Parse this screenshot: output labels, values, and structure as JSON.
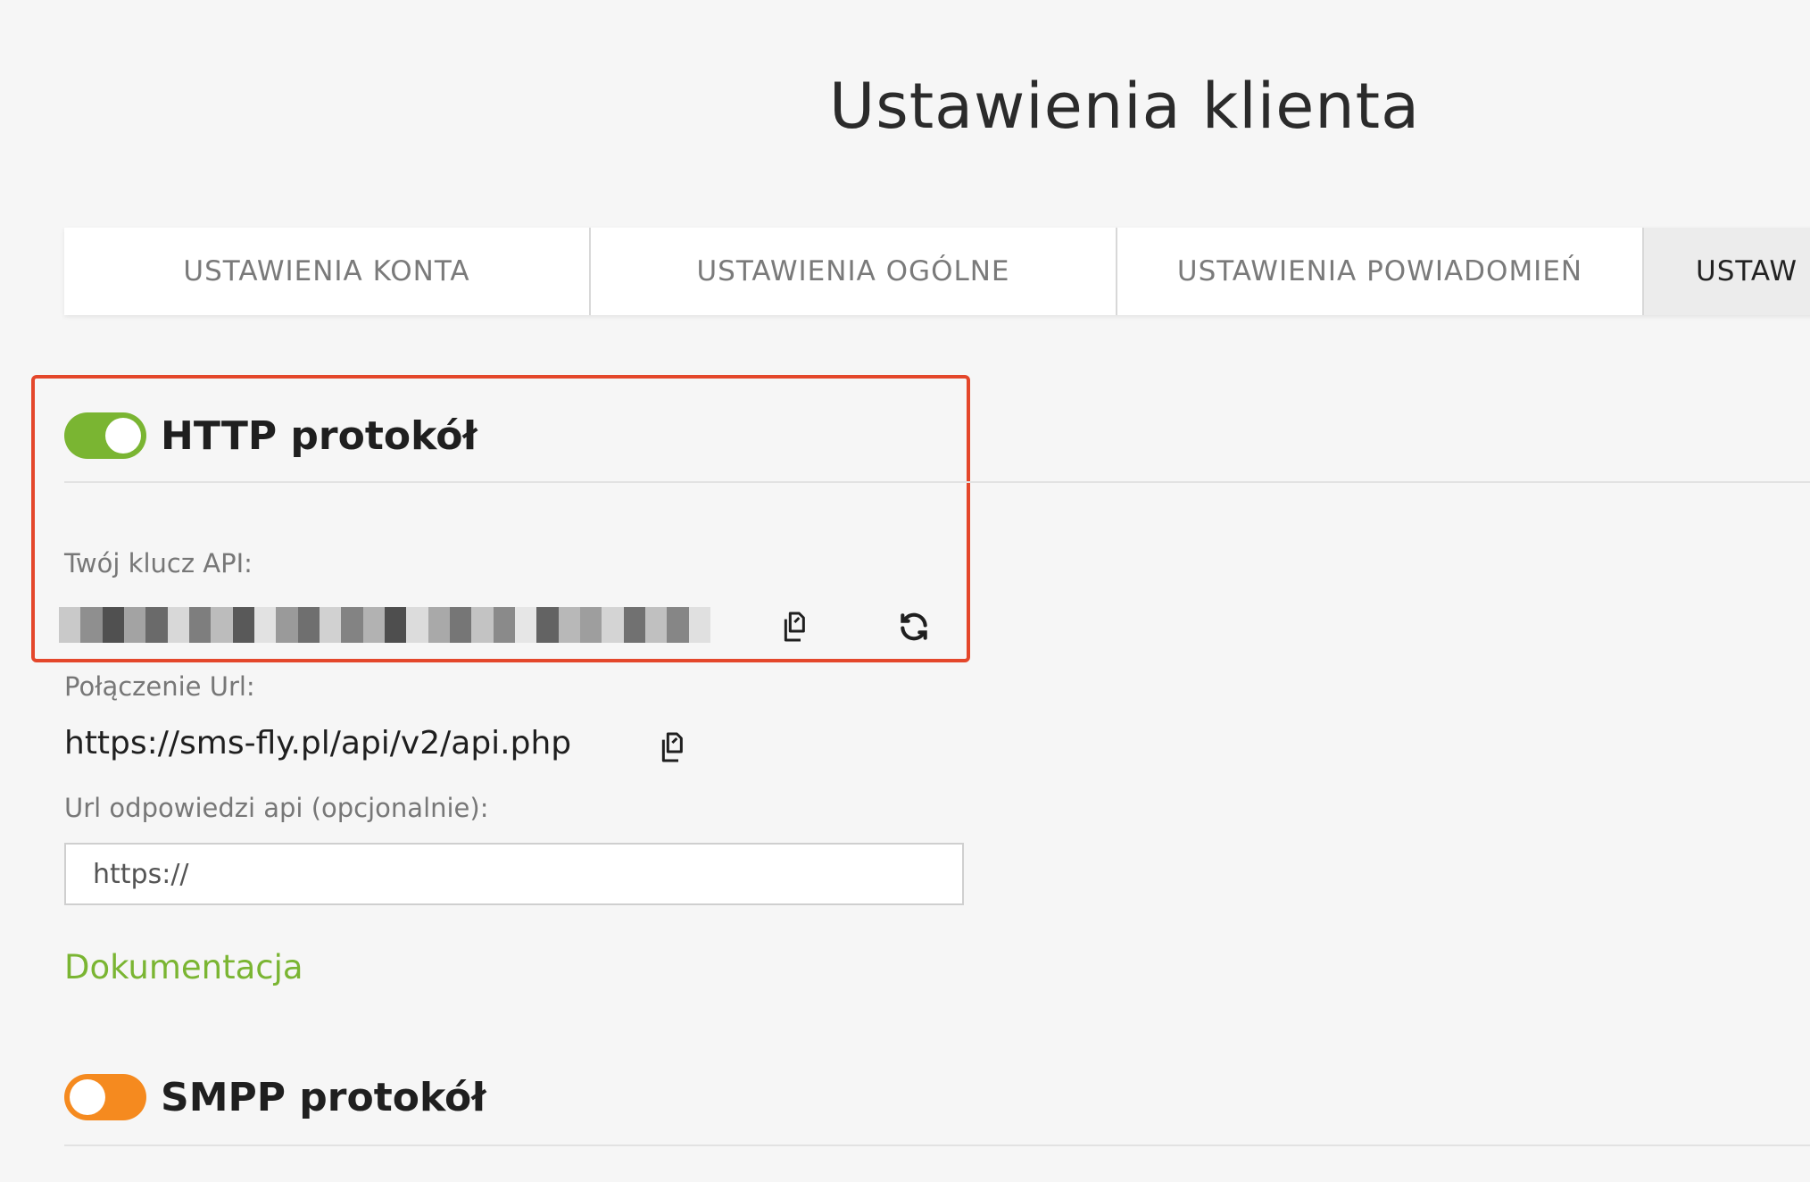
{
  "page": {
    "title": "Ustawienia klienta"
  },
  "tabs": [
    {
      "label": "USTAWIENIA KONTA"
    },
    {
      "label": "USTAWIENIA OGÓLNE"
    },
    {
      "label": "USTAWIENIA POWIADOMIEŃ"
    },
    {
      "label": "USTAW"
    }
  ],
  "http": {
    "title": "HTTP protokół",
    "enabled": true,
    "toggle_color": "#7ab532",
    "api_key_label": "Twój klucz API:",
    "connection_label": "Połączenie Url:",
    "connection_url": "https://sms-fly.pl/api/v2/api.php",
    "response_label": "Url odpowiedzi api (opcjonalnie):",
    "response_placeholder": "https://",
    "doc_link": "Dokumentacja",
    "icons": {
      "copy": "copy-icon",
      "refresh": "refresh-icon"
    }
  },
  "smpp": {
    "title": "SMPP protokół",
    "enabled": false,
    "toggle_color": "#f58a1f"
  },
  "colors": {
    "highlight": "#e4472b",
    "accent_green": "#7ab532",
    "accent_orange": "#f58a1f"
  }
}
